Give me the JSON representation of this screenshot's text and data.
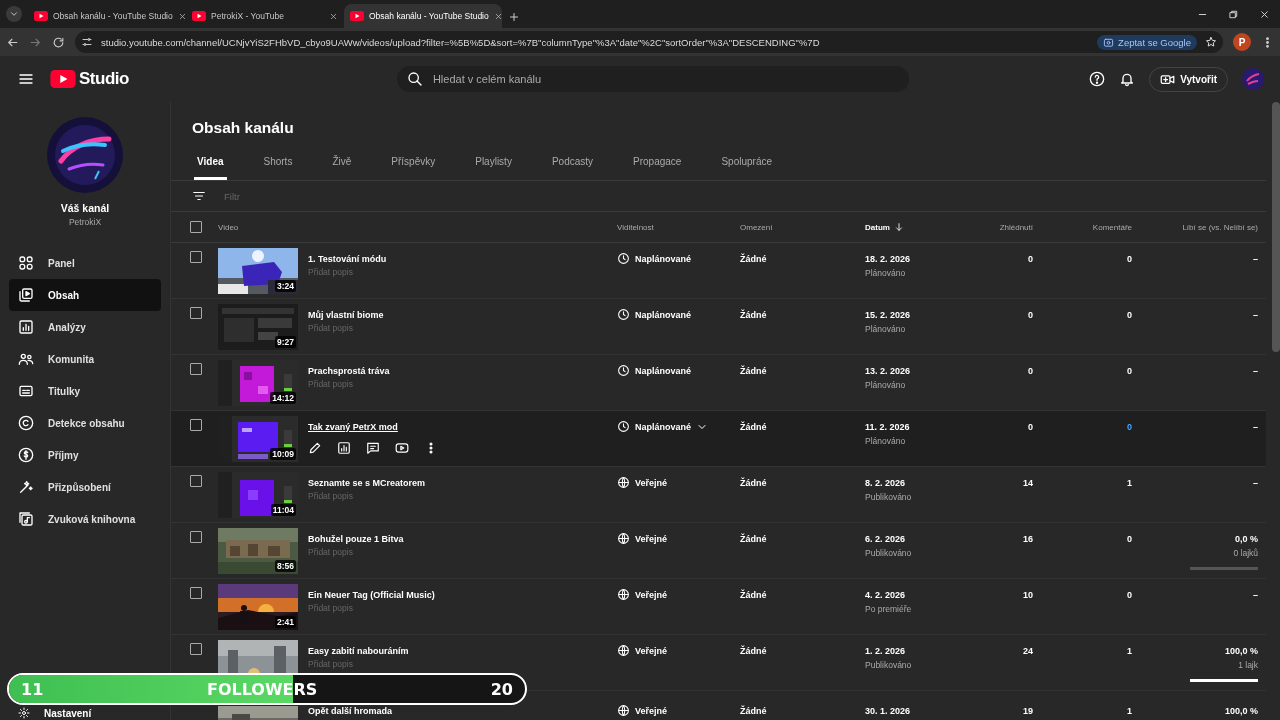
{
  "browser": {
    "tabs": [
      {
        "title": "Obsah kanálu - YouTube Studio",
        "selected": false
      },
      {
        "title": "PetrokiX - YouTube",
        "selected": false
      },
      {
        "title": "Obsah kanálu - YouTube Studio",
        "selected": true
      }
    ],
    "url": "studio.youtube.com/channel/UCNjvYiS2FHbVD_cbyo9UAWw/videos/upload?filter=%5B%5D&sort=%7B\"columnType\"%3A\"date\"%2C\"sortOrder\"%3A\"DESCENDING\"%7D",
    "ask_button": "Zeptat se Google",
    "profile_initial": "P"
  },
  "header": {
    "logo": "Studio",
    "search_placeholder": "Hledat v celém kanálu",
    "create_button": "Vytvořit"
  },
  "sidebar": {
    "channel_title": "Váš kanál",
    "channel_name": "PetrokiX",
    "items": [
      {
        "label": "Panel",
        "kind": "dashboard",
        "selected": false
      },
      {
        "label": "Obsah",
        "kind": "content",
        "selected": true
      },
      {
        "label": "Analýzy",
        "kind": "analytics",
        "selected": false
      },
      {
        "label": "Komunita",
        "kind": "community",
        "selected": false
      },
      {
        "label": "Titulky",
        "kind": "subtitles",
        "selected": false
      },
      {
        "label": "Detekce obsahu",
        "kind": "copyright",
        "selected": false
      },
      {
        "label": "Příjmy",
        "kind": "earn",
        "selected": false
      },
      {
        "label": "Přizpůsobení",
        "kind": "customize",
        "selected": false
      },
      {
        "label": "Zvuková knihovna",
        "kind": "audio",
        "selected": false
      }
    ],
    "settings": "Nastavení"
  },
  "page": {
    "title": "Obsah kanálu",
    "tabs": [
      {
        "label": "Videa",
        "selected": true
      },
      {
        "label": "Shorts",
        "selected": false
      },
      {
        "label": "Živě",
        "selected": false
      },
      {
        "label": "Příspěvky",
        "selected": false
      },
      {
        "label": "Playlisty",
        "selected": false
      },
      {
        "label": "Podcasty",
        "selected": false
      },
      {
        "label": "Propagace",
        "selected": false
      },
      {
        "label": "Spolupráce",
        "selected": false
      }
    ],
    "filter_placeholder": "Filtr"
  },
  "table": {
    "select_all_checked": false,
    "columns": [
      {
        "label": "Video",
        "sorted": false
      },
      {
        "label": "Viditelnost",
        "sorted": false
      },
      {
        "label": "Omezení",
        "sorted": false
      },
      {
        "label": "Datum",
        "sorted": true
      },
      {
        "label": "Zhlédnutí",
        "sorted": false
      },
      {
        "label": "Komentáře",
        "sorted": false
      },
      {
        "label": "Líbí se (vs. Nelíbí se)",
        "sorted": false
      }
    ],
    "rows": [
      {
        "checked": false,
        "hovered": false,
        "duration": "3:24",
        "title": "1. Testování módu",
        "description": "Přidat popis",
        "visibility": {
          "kind": "scheduled",
          "label": "Naplánované"
        },
        "restriction": "Žádné",
        "date": "18. 2. 2026",
        "status": "Plánováno",
        "views": "0",
        "comments": "0",
        "likes": {
          "value": "–"
        }
      },
      {
        "checked": false,
        "hovered": false,
        "duration": "9:27",
        "title": "Můj vlastní biome",
        "description": "Přidat popis",
        "visibility": {
          "kind": "scheduled",
          "label": "Naplánované"
        },
        "restriction": "Žádné",
        "date": "15. 2. 2026",
        "status": "Plánováno",
        "views": "0",
        "comments": "0",
        "likes": {
          "value": "–"
        }
      },
      {
        "checked": false,
        "hovered": false,
        "duration": "14:12",
        "title": "Prachsprostá tráva",
        "description": "Přidat popis",
        "visibility": {
          "kind": "scheduled",
          "label": "Naplánované"
        },
        "restriction": "Žádné",
        "date": "13. 2. 2026",
        "status": "Plánováno",
        "views": "0",
        "comments": "0",
        "likes": {
          "value": "–"
        }
      },
      {
        "checked": false,
        "hovered": true,
        "duration": "10:09",
        "title": "Tak zvaný PetrX mod",
        "visibility": {
          "kind": "scheduled",
          "label": "Naplánované"
        },
        "restriction": "Žádné",
        "date": "11. 2. 2026",
        "status": "Plánováno",
        "views": "0",
        "comments": "0",
        "likes": {
          "value": "–"
        }
      },
      {
        "checked": false,
        "hovered": false,
        "duration": "11:04",
        "title": "Seznamte se s MCreatorem",
        "description": "Přidat popis",
        "visibility": {
          "kind": "public",
          "label": "Veřejné"
        },
        "restriction": "Žádné",
        "date": "8. 2. 2026",
        "status": "Publikováno",
        "views": "14",
        "comments": "1",
        "likes": {
          "value": "–"
        }
      },
      {
        "checked": false,
        "hovered": false,
        "duration": "8:56",
        "title": "Bohužel pouze 1 Bitva",
        "description": "Přidat popis",
        "visibility": {
          "kind": "public",
          "label": "Veřejné"
        },
        "restriction": "Žádné",
        "date": "6. 2. 2026",
        "status": "Publikováno",
        "views": "16",
        "comments": "0",
        "likes": {
          "value": "0,0 %",
          "count": "0 lajků",
          "level": 0
        }
      },
      {
        "checked": false,
        "hovered": false,
        "duration": "2:41",
        "title": "Ein Neuer Tag (Official Music)",
        "description": "Přidat popis",
        "visibility": {
          "kind": "public",
          "label": "Veřejné"
        },
        "restriction": "Žádné",
        "date": "4. 2. 2026",
        "status": "Po premiéře",
        "views": "10",
        "comments": "0",
        "likes": {
          "value": "–"
        }
      },
      {
        "checked": false,
        "hovered": false,
        "title": "Easy zabití nabouráním",
        "description": "Přidat popis",
        "visibility": {
          "kind": "public",
          "label": "Veřejné"
        },
        "restriction": "Žádné",
        "date": "1. 2. 2026",
        "status": "Publikováno",
        "views": "24",
        "comments": "1",
        "likes": {
          "value": "100,0 %",
          "count": "1 lajk",
          "level": 1
        }
      },
      {
        "title": "Opět další hromada",
        "visibility": {
          "kind": "public",
          "label": "Veřejné"
        },
        "restriction": "Žádné",
        "date": "30. 1. 2026",
        "views": "19",
        "comments": "1",
        "likes": {
          "value": "100,0 %"
        }
      }
    ]
  },
  "overlay": {
    "current": "11",
    "label": "FOLLOWERS",
    "goal": "20",
    "level": 0.55
  }
}
